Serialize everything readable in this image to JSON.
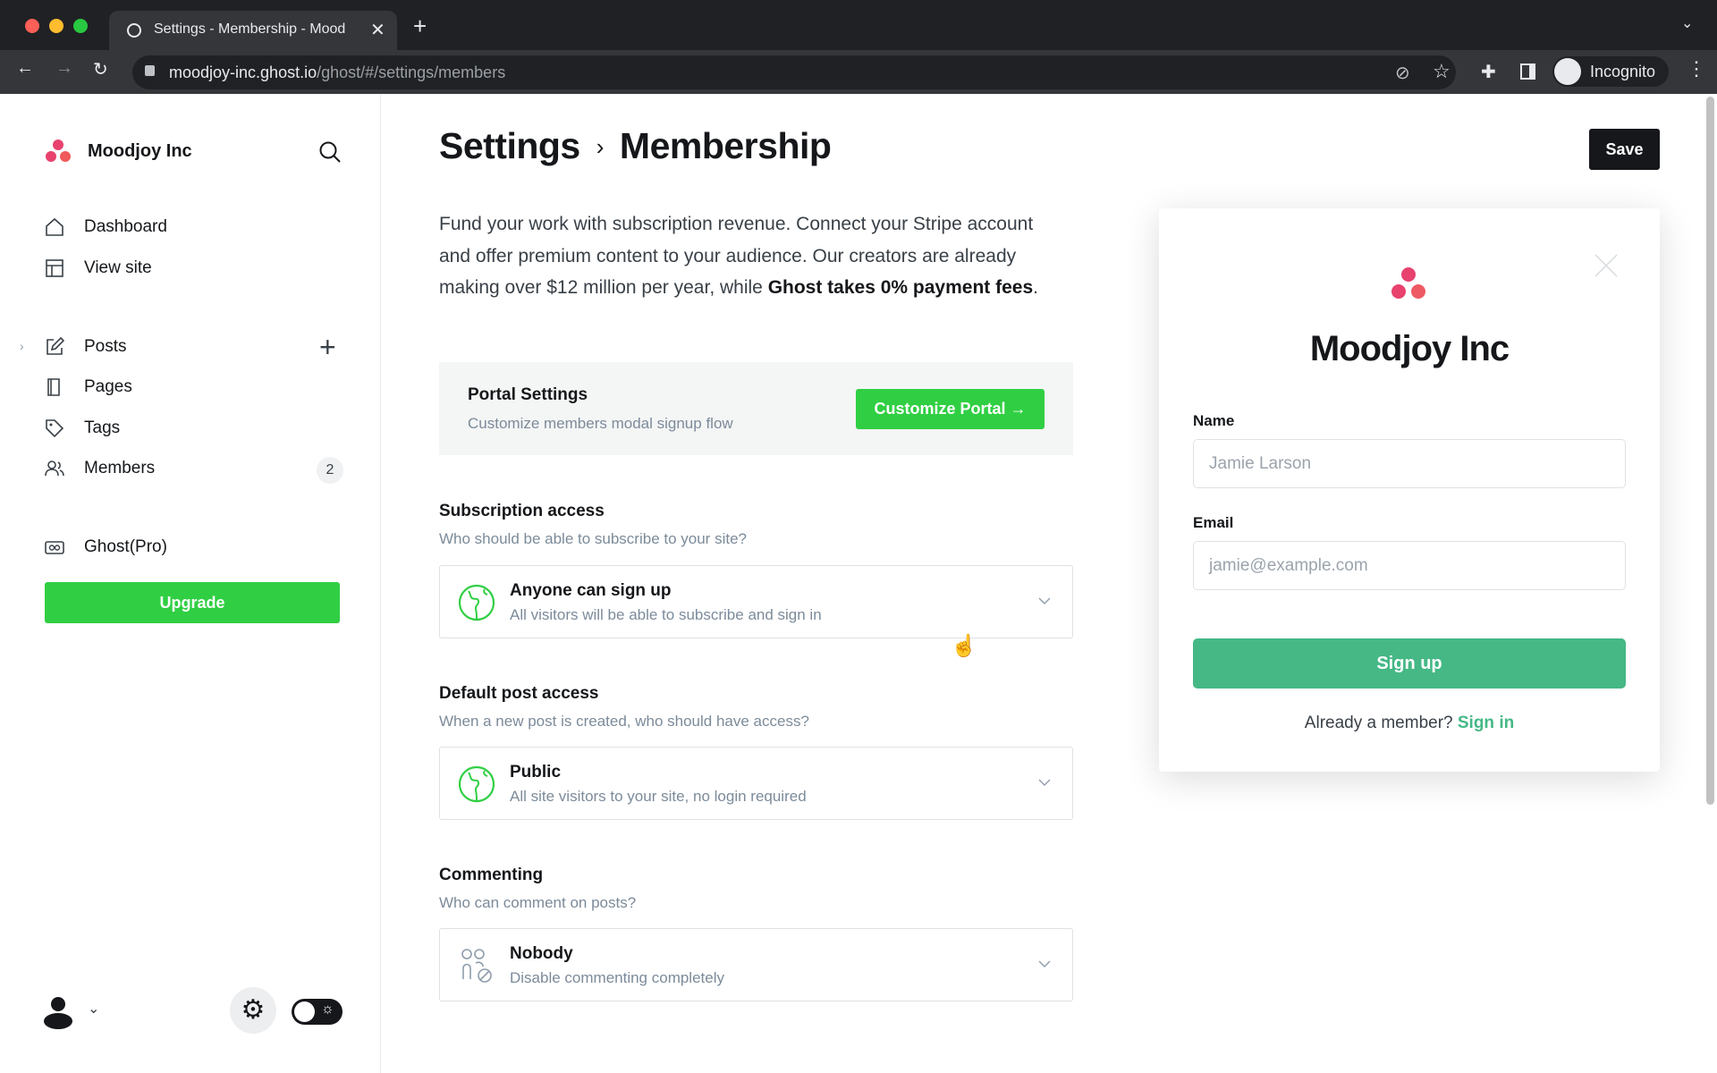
{
  "browser": {
    "tab_title": "Settings - Membership - Mood",
    "url_host": "moodjoy-inc.ghost.io",
    "url_path": "/ghost/#/settings/members",
    "profile": "Incognito"
  },
  "sidebar": {
    "site_name": "Moodjoy Inc",
    "items": [
      {
        "label": "Dashboard",
        "icon": "home-icon"
      },
      {
        "label": "View site",
        "icon": "layout-icon"
      },
      {
        "label": "Posts",
        "icon": "pencil-icon"
      },
      {
        "label": "Pages",
        "icon": "page-icon"
      },
      {
        "label": "Tags",
        "icon": "tag-icon"
      },
      {
        "label": "Members",
        "icon": "members-icon",
        "badge": "2"
      },
      {
        "label": "Ghost(Pro)",
        "icon": "ghost-pro-icon"
      }
    ],
    "upgrade": "Upgrade"
  },
  "header": {
    "crumb": "Settings",
    "title": "Membership",
    "save": "Save"
  },
  "intro": {
    "text": "Fund your work with subscription revenue. Connect your Stripe account and offer premium content to your audience. Our creators are already making over $12 million per year, while ",
    "bold": "Ghost takes 0% payment fees",
    "end": "."
  },
  "portal": {
    "title": "Portal Settings",
    "subtitle": "Customize members modal signup flow",
    "button": "Customize Portal →"
  },
  "sections": [
    {
      "title": "Subscription access",
      "subtitle": "Who should be able to subscribe to your site?",
      "value": "Anyone can sign up",
      "desc": "All visitors will be able to subscribe and sign in"
    },
    {
      "title": "Default post access",
      "subtitle": "When a new post is created, who should have access?",
      "value": "Public",
      "desc": "All site visitors to your site, no login required"
    },
    {
      "title": "Commenting",
      "subtitle": "Who can comment on posts?",
      "value": "Nobody",
      "desc": "Disable commenting completely"
    }
  ],
  "preview": {
    "site_name": "Moodjoy Inc",
    "name_label": "Name",
    "name_placeholder": "Jamie Larson",
    "email_label": "Email",
    "email_placeholder": "jamie@example.com",
    "signup": "Sign up",
    "already": "Already a member?",
    "signin": "Sign in"
  },
  "colors": {
    "green": "#30cf43",
    "signup": "#45b886",
    "brand_pink": "#e8426f"
  }
}
